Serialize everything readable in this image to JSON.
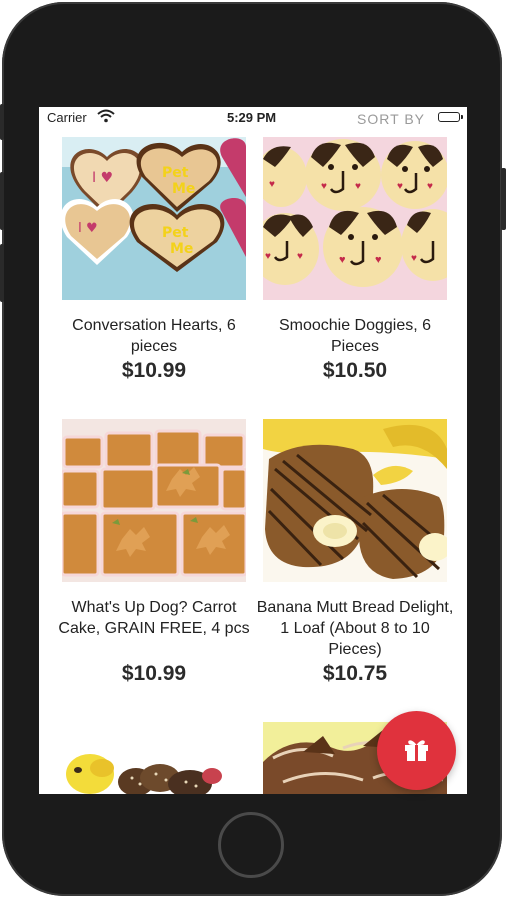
{
  "status_bar": {
    "carrier": "Carrier",
    "time": "5:29 PM",
    "battery_level": 1.0
  },
  "header": {
    "sort_label": "SORT BY"
  },
  "products": [
    {
      "name": "Conversation Hearts, 6 pieces",
      "price": "$10.99",
      "image": "heart-cookies-image"
    },
    {
      "name": "Smoochie Doggies, 6 Pieces",
      "price": "$10.50",
      "image": "dog-face-cookies-image"
    },
    {
      "name": "What's Up Dog? Carrot Cake, GRAIN FREE, 4 pcs",
      "price": "$10.99",
      "image": "carrot-cake-squares-image"
    },
    {
      "name": "Banana Mutt Bread Delight, 1 Loaf (About 8 to 10 Pieces)",
      "price": "$10.75",
      "image": "banana-bread-image"
    },
    {
      "image": "dog-treats-assortment-image"
    },
    {
      "image": "chocolate-twist-treats-image"
    }
  ],
  "fab": {
    "icon": "gift-icon",
    "color": "#e0323d"
  },
  "colors": {
    "accent": "#e0323d",
    "sort_text": "#9a9a9a"
  }
}
